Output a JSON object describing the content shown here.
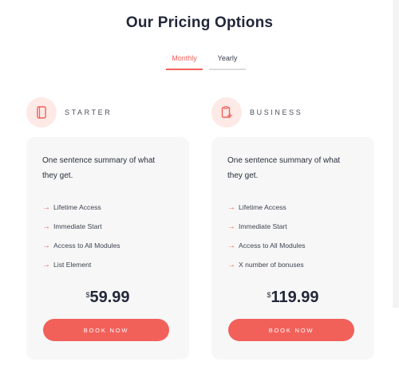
{
  "page": {
    "title": "Our Pricing Options"
  },
  "tabs": [
    {
      "label": "Monthly",
      "active": true
    },
    {
      "label": "Yearly",
      "active": false
    }
  ],
  "colors": {
    "accent": "#f1615a",
    "icon_bg": "#fde9e6",
    "card_bg": "#f7f7f7",
    "heading": "#22283a"
  },
  "plans": [
    {
      "name": "STARTER",
      "icon": "notebook-icon",
      "summary": "One sentence summary of what they get.",
      "features": [
        "Lifetime Access",
        "Immediate Start",
        "Access to All Modules",
        "List Element"
      ],
      "currency": "$",
      "price": "59.99",
      "button": "BOOK NOW"
    },
    {
      "name": "BUSINESS",
      "icon": "clipboard-plus-icon",
      "summary": "One sentence summary of what they get.",
      "features": [
        "Lifetime Access",
        "Immediate Start",
        "Access to All Modules",
        "X number of bonuses"
      ],
      "currency": "$",
      "price": "119.99",
      "button": "BOOK NOW"
    }
  ]
}
